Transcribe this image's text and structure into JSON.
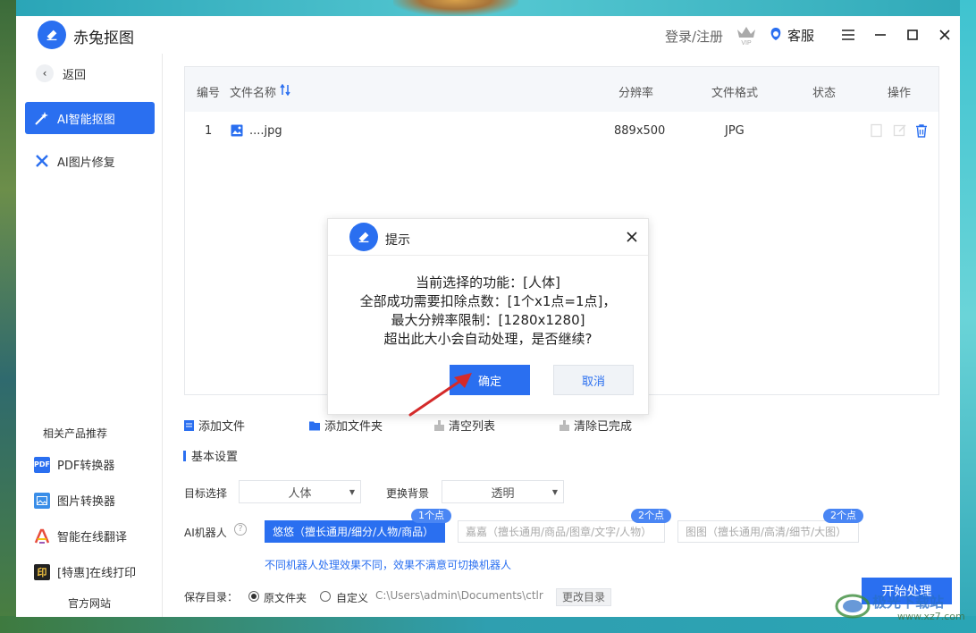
{
  "colors": {
    "accent": "#2a6ff0",
    "badge": "#4a86f4",
    "hint": "#2a6ff0"
  },
  "titlebar": {
    "title": "赤兔抠图",
    "login": "登录/注册",
    "service": "客服",
    "icons": [
      "app-logo-icon",
      "vip-crown-icon",
      "service-icon",
      "menu-icon",
      "minimize-icon",
      "maximize-icon",
      "close-icon"
    ]
  },
  "sidebar": {
    "back_label": "返回",
    "items": [
      {
        "label": "AI智能抠图",
        "icon": "magic-wand-icon",
        "active": true
      },
      {
        "label": "AI图片修复",
        "icon": "tools-icon",
        "active": false
      }
    ],
    "related_heading": "相关产品推荐",
    "products": [
      {
        "label": "PDF转换器",
        "icon": "pdf-icon",
        "badge": "PDF"
      },
      {
        "label": "图片转换器",
        "icon": "image-converter-icon"
      },
      {
        "label": "智能在线翻译",
        "icon": "translate-icon"
      },
      {
        "label": "[特惠]在线打印",
        "icon": "print-icon",
        "badge": "印"
      }
    ],
    "official_site": "官方网站"
  },
  "table": {
    "headers": {
      "num": "编号",
      "name": "文件名称",
      "resolution": "分辨率",
      "format": "文件格式",
      "status": "状态",
      "ops": "操作"
    },
    "rows": [
      {
        "num": "1",
        "name": "....jpg",
        "resolution": "889x500",
        "format": "JPG",
        "status": ""
      }
    ]
  },
  "actions": {
    "add_file": "添加文件",
    "add_folder": "添加文件夹",
    "clear_list": "清空列表",
    "clear_done": "清除已完成"
  },
  "settings": {
    "title": "基本设置",
    "target_label": "目标选择",
    "target_value": "人体",
    "bg_label": "更换背景",
    "bg_value": "透明",
    "robot_label": "AI机器人",
    "help": "?",
    "robots": [
      {
        "label": "悠悠（擅长通用/细分/人物/商品）",
        "badge": "1个点",
        "active": true
      },
      {
        "label": "嘉嘉（擅长通用/商品/图章/文字/人物）",
        "badge": "2个点",
        "active": false
      },
      {
        "label": "图图（擅长通用/高清/细节/大图）",
        "badge": "2个点",
        "active": false
      }
    ],
    "hint": "不同机器人处理效果不同，效果不满意可切换机器人",
    "save_label": "保存目录：",
    "option_original": "原文件夹",
    "option_custom": "自定义",
    "path": "C:\\Users\\admin\\Documents\\ctlr",
    "change_dir": "更改目录",
    "start": "开始处理"
  },
  "dialog": {
    "title": "提示",
    "lines": [
      "当前选择的功能：[人体]",
      "全部成功需要扣除点数：[1个x1点=1点]，",
      "最大分辨率限制：[1280x1280]",
      "超出此大小会自动处理，是否继续?"
    ],
    "ok": "确定",
    "cancel": "取消"
  },
  "watermark": {
    "text": "极光下载站",
    "url": "www.xz7.com"
  }
}
